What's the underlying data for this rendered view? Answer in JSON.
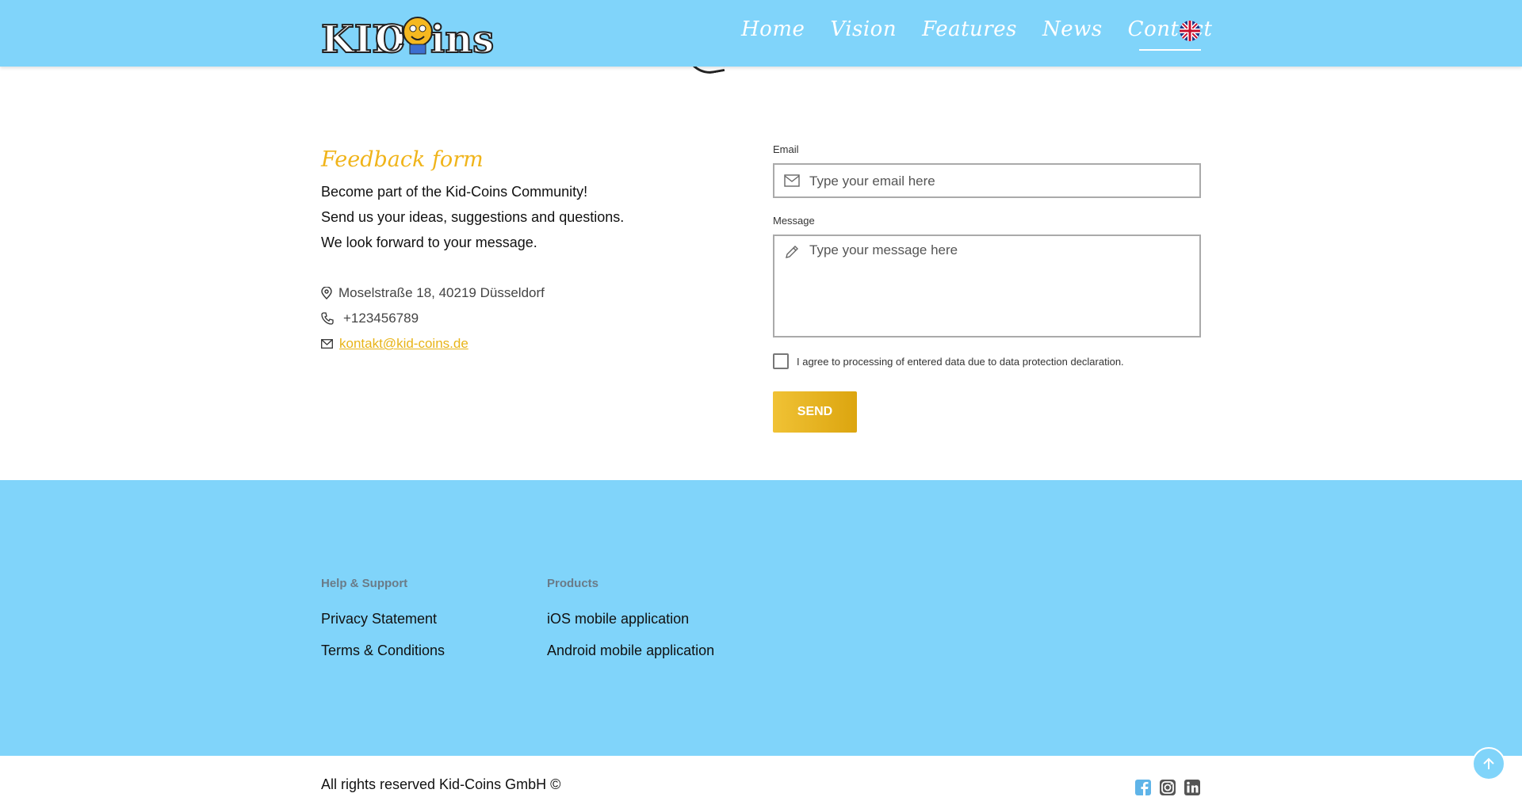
{
  "header": {
    "logo_alt": "KID COINS",
    "nav": [
      {
        "label": "Home"
      },
      {
        "label": "Vision"
      },
      {
        "label": "Features"
      },
      {
        "label": "News"
      },
      {
        "label": "Contact",
        "active": true
      }
    ],
    "language_icon": "uk-flag-icon"
  },
  "feedback": {
    "title": "Feedback form",
    "lines": [
      "Become part of the Kid-Coins Community!",
      "Send us your ideas, suggestions and questions.",
      "We look forward to your message."
    ],
    "address": "Moselstraße 18, 40219 Düsseldorf",
    "phone": "+123456789",
    "email": "kontakt@kid-coins.de"
  },
  "form": {
    "email_label": "Email",
    "email_placeholder": "Type your email here",
    "message_label": "Message",
    "message_placeholder": "Type your message here",
    "agree_text": "I agree to processing of entered data due to data protection declaration.",
    "send_label": "SEND"
  },
  "footer": {
    "help_head": "Help & Support",
    "help_links": [
      "Privacy Statement",
      "Terms & Conditions"
    ],
    "products_head": "Products",
    "product_links": [
      "iOS mobile application",
      "Android mobile application"
    ],
    "copyright": "All rights reserved Kid-Coins GmbH ©",
    "socials": [
      "facebook-icon",
      "instagram-icon",
      "linkedin-icon"
    ]
  },
  "colors": {
    "header_bg": "#80d4fa",
    "accent": "#f0b41a",
    "footer_bg": "#80d4fa"
  }
}
